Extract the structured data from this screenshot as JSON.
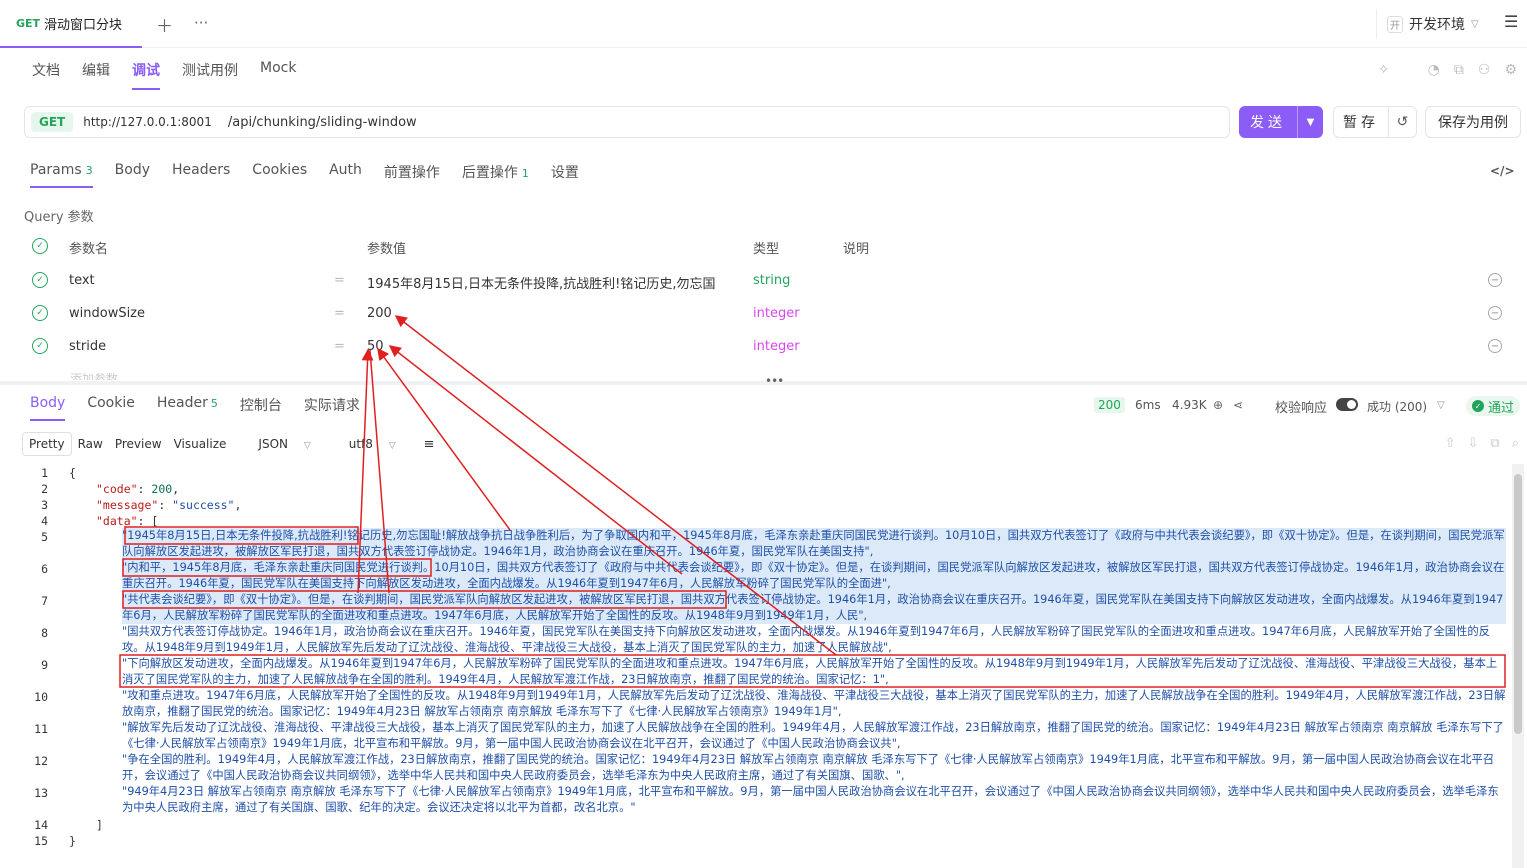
{
  "top": {
    "tab_method": "GET",
    "tab_title": "滑动窗口分块",
    "add_icon": "plus-icon",
    "more_icon": "more-icon",
    "env_badge": "开",
    "env_label": "开发环境",
    "env_chev": "⌵"
  },
  "doc_tabs": [
    "文档",
    "编辑",
    "调试",
    "测试用例",
    "Mock"
  ],
  "url": {
    "method": "GET",
    "host": "http://127.0.0.1:8001",
    "path": "/api/chunking/sliding-window"
  },
  "buttons": {
    "send": "发送",
    "save": "暂存",
    "save_case": "保存为用例"
  },
  "param_tabs": [
    {
      "label": "Params",
      "count": "3"
    },
    {
      "label": "Body",
      "count": ""
    },
    {
      "label": "Headers",
      "count": ""
    },
    {
      "label": "Cookies",
      "count": ""
    },
    {
      "label": "Auth",
      "count": ""
    },
    {
      "label": "前置操作",
      "count": ""
    },
    {
      "label": "后置操作",
      "count": "1"
    },
    {
      "label": "设置",
      "count": ""
    }
  ],
  "query": {
    "section_label": "Query 参数",
    "headers": {
      "name": "参数名",
      "value": "参数值",
      "type": "类型",
      "desc": "说明"
    },
    "rows": [
      {
        "name": "text",
        "value": "1945年8月15日,日本无条件投降,抗战胜利!铭记历史,勿忘国",
        "type": "string"
      },
      {
        "name": "windowSize",
        "value": "200",
        "type": "integer"
      },
      {
        "name": "stride",
        "value": "50",
        "type": "integer"
      }
    ],
    "add_param": "添加参数"
  },
  "response_tabs": [
    {
      "label": "Body",
      "count": ""
    },
    {
      "label": "Cookie",
      "count": ""
    },
    {
      "label": "Header",
      "count": "5"
    },
    {
      "label": "控制台",
      "count": ""
    },
    {
      "label": "实际请求",
      "count": ""
    }
  ],
  "status": {
    "code": "200",
    "time": "6ms",
    "size": "4.93K",
    "validate_label": "校验响应",
    "result": "成功 (200)",
    "pass": "通过"
  },
  "view_tabs": [
    "Pretty",
    "Raw",
    "Preview",
    "Visualize"
  ],
  "view_format": "JSON",
  "view_encoding": "utf8",
  "code": {
    "line_numbers": [
      "1",
      "2",
      "3",
      "4",
      "5",
      "6",
      "7",
      "8",
      "9",
      "10",
      "11",
      "12",
      "13",
      "14",
      "15"
    ],
    "open_brace": "{",
    "code_key": "\"code\"",
    "code_val": "200",
    "message_key": "\"message\"",
    "message_val": "\"success\"",
    "data_key": "\"data\"",
    "data_open": ": [",
    "close_bracket": "]",
    "close_brace": "}",
    "chunks": [
      "\"1945年8月15日,日本无条件投降,抗战胜利!铭记历史,勿忘国耻!解放战争抗日战争胜利后，为了争取国内和平，1945年8月底，毛泽东亲赴重庆同国民党进行谈判。10月10日，国共双方代表签订了《政府与中共代表会谈纪要》，即《双十协定》。但是，在谈判期间，国民党派军队向解放区发起进攻，被解放区军民打退，国共双方代表签订停战协定。1946年1月，政治协商会议在重庆召开。1946年夏，国民党军队在美国支持\",",
      "\"内和平，1945年8月底，毛泽东亲赴重庆同国民党进行谈判。10月10日，国共双方代表签订了《政府与中共代表会谈纪要》，即《双十协定》。但是，在谈判期间，国民党派军队向解放区发起进攻，被解放区军民打退，国共双方代表签订停战协定。1946年1月，政治协商会议在重庆召开。1946年夏，国民党军队在美国支持下向解放区发动进攻，全面内战爆发。从1946年夏到1947年6月，人民解放军粉碎了国民党军队的全面进\",",
      "\"共代表会谈纪要》，即《双十协定》。但是，在谈判期间，国民党派军队向解放区发起进攻，被解放区军民打退，国共双方代表签订停战协定。1946年1月，政治协商会议在重庆召开。1946年夏，国民党军队在美国支持下向解放区发动进攻，全面内战爆发。从1946年夏到1947年6月，人民解放军粉碎了国民党军队的全面进攻和重点进攻。1947年6月底，人民解放军开始了全国性的反攻。从1948年9月到1949年1月，人民\",",
      "\"国共双方代表签订停战协定。1946年1月，政治协商会议在重庆召开。1946年夏，国民党军队在美国支持下向解放区发动进攻，全面内战爆发。从1946年夏到1947年6月，人民解放军粉碎了国民党军队的全面进攻和重点进攻。1947年6月底，人民解放军开始了全国性的反攻。从1948年9月到1949年1月，人民解放军先后发动了辽沈战役、淮海战役、平津战役三大战役，基本上消灭了国民党军队的主力，加速了人民解放战\",",
      "\"下向解放区发动进攻，全面内战爆发。从1946年夏到1947年6月，人民解放军粉碎了国民党军队的全面进攻和重点进攻。1947年6月底，人民解放军开始了全国性的反攻。从1948年9月到1949年1月，人民解放军先后发动了辽沈战役、淮海战役、平津战役三大战役，基本上消灭了国民党军队的主力，加速了人民解放战争在全国的胜利。1949年4月，人民解放军渡江作战，23日解放南京，推翻了国民党的统治。国家记忆：1\",",
      "\"攻和重点进攻。1947年6月底，人民解放军开始了全国性的反攻。从1948年9月到1949年1月，人民解放军先后发动了辽沈战役、淮海战役、平津战役三大战役，基本上消灭了国民党军队的主力，加速了人民解放战争在全国的胜利。1949年4月，人民解放军渡江作战，23日解放南京，推翻了国民党的统治。国家记忆：1949年4月23日 解放军占领南京 南京解放 毛泽东写下了《七律·人民解放军占领南京》1949年1月\",",
      "\"解放军先后发动了辽沈战役、淮海战役、平津战役三大战役，基本上消灭了国民党军队的主力，加速了人民解放战争在全国的胜利。1949年4月，人民解放军渡江作战，23日解放南京，推翻了国民党的统治。国家记忆：1949年4月23日 解放军占领南京 南京解放 毛泽东写下了《七律·人民解放军占领南京》1949年1月底，北平宣布和平解放。9月，第一届中国人民政治协商会议在北平召开，会议通过了《中国人民政治协商会议共\",",
      "\"争在全国的胜利。1949年4月，人民解放军渡江作战，23日解放南京，推翻了国民党的统治。国家记忆：1949年4月23日 解放军占领南京 南京解放 毛泽东写下了《七律·人民解放军占领南京》1949年1月底，北平宣布和平解放。9月，第一届中国人民政治协商会议在北平召开，会议通过了《中国人民政治协商会议共同纲领》，选举中华人民共和国中央人民政府委员会，选举毛泽东为中央人民政府主席，通过了有关国旗、国歌、\",",
      "\"949年4月23日 解放军占领南京 南京解放 毛泽东写下了《七律·人民解放军占领南京》1949年1月底，北平宣布和平解放。9月，第一届中国人民政治协商会议在北平召开，会议通过了《中国人民政治协商会议共同纲领》，选举中华人民共和国中央人民政府委员会，选举毛泽东为中央人民政府主席，通过了有关国旗、国歌、纪年的决定。会议还决定将以北平为首都，改名北京。\""
    ]
  },
  "colors": {
    "accent": "#8b5cf6",
    "success": "#22a55b",
    "integer": "#d946ef",
    "annotation": "#e02020"
  }
}
